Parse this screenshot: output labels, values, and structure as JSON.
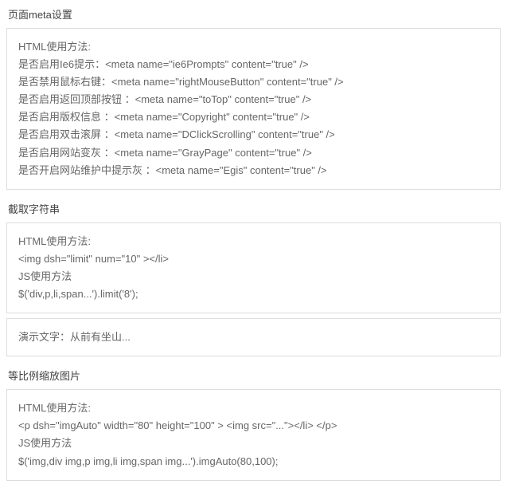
{
  "sections": [
    {
      "title": "页面meta设置",
      "boxes": [
        {
          "lines": [
            "HTML使用方法:",
            "是否启用Ie6提示：<meta name=\"ie6Prompts\" content=\"true\" />",
            "是否禁用鼠标右键：<meta name=\"rightMouseButton\" content=\"true\" />",
            "是否启用返回顶部按钮 ：<meta name=\"toTop\" content=\"true\" />",
            "是否启用版权信息 ：<meta name=\"Copyright\" content=\"true\" />",
            "是否启用双击滚屏 ：<meta name=\"DClickScrolling\" content=\"true\" />",
            "是否启用网站变灰 ：<meta name=\"GrayPage\" content=\"true\" />",
            "是否开启网站维护中提示灰 ：<meta name=\"Egis\" content=\"true\" />"
          ]
        }
      ]
    },
    {
      "title": "截取字符串",
      "boxes": [
        {
          "lines": [
            "HTML使用方法:",
            "<img dsh=\"limit\" num=\"10\" ></li>",
            "JS使用方法",
            "$('div,p,li,span...').limit('8');"
          ]
        },
        {
          "lines": [
            "演示文字：从前有坐山..."
          ]
        }
      ]
    },
    {
      "title": "等比例缩放图片",
      "boxes": [
        {
          "lines": [
            "HTML使用方法:",
            "<p dsh=\"imgAuto\" width=\"80\" height=\"100\" > <img src=\"...\"></li> </p>",
            "JS使用方法",
            "$('img,div img,p img,li img,span img...').imgAuto(80,100);"
          ]
        }
      ]
    }
  ]
}
